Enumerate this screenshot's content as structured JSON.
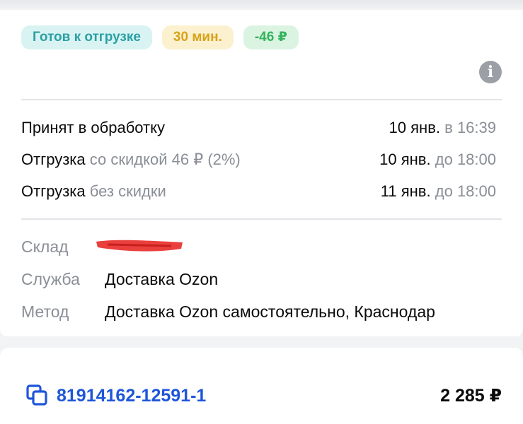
{
  "chips": {
    "status": "Готов к отгрузке",
    "time": "30 мин.",
    "discount": "-46 ₽"
  },
  "icons": {
    "info": "info-icon",
    "copy": "copy-icon"
  },
  "schedule": [
    {
      "label": "Принят в обработку",
      "detail": "",
      "date": "10 янв.",
      "time_prefix": "в",
      "time": "16:39"
    },
    {
      "label": "Отгрузка",
      "detail": "со скидкой 46 ₽ (2%)",
      "date": "10 янв.",
      "time_prefix": "до",
      "time": "18:00"
    },
    {
      "label": "Отгрузка",
      "detail": "без скидки",
      "date": "11 янв.",
      "time_prefix": "до",
      "time": "18:00"
    }
  ],
  "details": {
    "warehouse_label": "Склад",
    "service_label": "Служба",
    "service_value": "Доставка Ozon",
    "method_label": "Метод",
    "method_value": "Доставка Ozon самостоятельно, Краснодар"
  },
  "order": {
    "number": "81914162-12591-1",
    "price": "2 285 ₽"
  },
  "colors": {
    "status_chip_bg": "#d9f3f3",
    "status_chip_text": "#2aa0a3",
    "time_chip_bg": "#fbf1cf",
    "time_chip_text": "#d8a21a",
    "discount_chip_bg": "#dbf4e2",
    "discount_chip_text": "#35b35d",
    "link": "#1e56d9",
    "redaction": "#e8302c"
  }
}
